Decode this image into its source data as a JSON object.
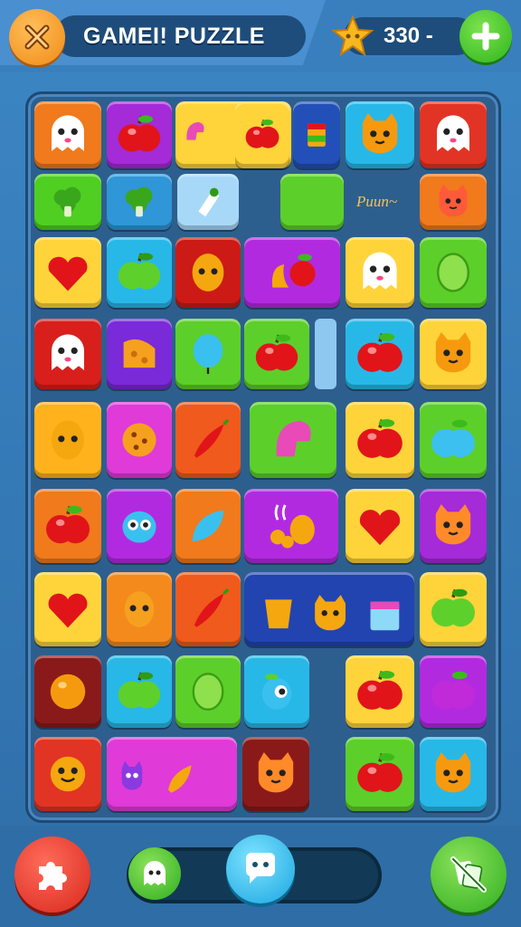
{
  "header": {
    "title": "GAMEI! PUZZLE",
    "score": "330 -",
    "close_icon": "close-x-icon",
    "star_icon": "star-icon",
    "add_icon": "plus-icon"
  },
  "board": {
    "label": "Puun~",
    "rows": [
      [
        "ghost",
        "apple",
        "heart-candy",
        "apple",
        "striped-block",
        "cat",
        "ghost"
      ],
      [
        "broccoli",
        "broccoli",
        "candy",
        "empty",
        "green-block",
        "label",
        "cat"
      ],
      [
        "heart",
        "apple-green",
        "mango",
        "candy-apple",
        "ghost",
        "lime"
      ],
      [
        "ghost",
        "cheese",
        "balloon",
        "apple",
        "gap",
        "apple",
        "cat"
      ],
      [
        "mango",
        "cookie",
        "chili",
        "heart-candy",
        "apple",
        "apple-blue"
      ],
      [
        "apple",
        "blob",
        "leaf",
        "candy-cluster",
        "heart",
        "cat"
      ],
      [
        "heart",
        "potato",
        "chili",
        "cup-cat-box",
        "apple-green"
      ],
      [
        "orange",
        "apple-green",
        "lime",
        "eye-fruit",
        "apple",
        "apple-purple"
      ],
      [
        "smile",
        "monster-banana",
        "cat",
        "apple",
        "cat"
      ]
    ]
  },
  "footer": {
    "left_icon": "puzzle-piece-icon",
    "track_icon": "ghost-icon",
    "chat_icon": "chat-bubble-icon",
    "right_icon": "no-cards-icon"
  },
  "colors": {
    "background": "#3479b6",
    "board": "#2d5f8e",
    "accent_orange": "#f08a16",
    "accent_green": "#2fb51c",
    "accent_red": "#d8281c",
    "accent_cyan": "#1aa6e0"
  }
}
